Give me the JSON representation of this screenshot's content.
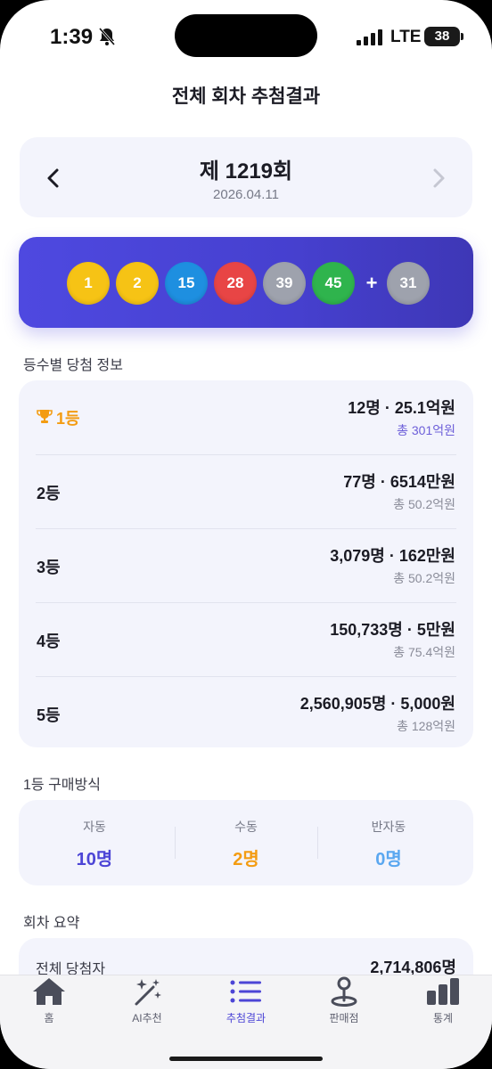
{
  "status": {
    "time": "1:39",
    "network": "LTE",
    "battery": "38"
  },
  "header": {
    "title": "전체 회차 추첨결과"
  },
  "round": {
    "title": "제 1219회",
    "date": "2026.04.11"
  },
  "balls": [
    {
      "number": "1",
      "color": "#f6c315"
    },
    {
      "number": "2",
      "color": "#f6c315"
    },
    {
      "number": "15",
      "color": "#1e8fe0"
    },
    {
      "number": "28",
      "color": "#e84545"
    },
    {
      "number": "39",
      "color": "#9ea2ad"
    },
    {
      "number": "45",
      "color": "#2fb44d"
    }
  ],
  "plus": "+",
  "bonus": {
    "number": "31",
    "color": "#9ea2ad"
  },
  "prize_section": {
    "label": "등수별 당첨 정보"
  },
  "prizes": [
    {
      "rank": "1등",
      "main": "12명 · 25.1억원",
      "total": "총 301억원"
    },
    {
      "rank": "2등",
      "main": "77명 · 6514만원",
      "total": "총 50.2억원"
    },
    {
      "rank": "3등",
      "main": "3,079명 · 162만원",
      "total": "총 50.2억원"
    },
    {
      "rank": "4등",
      "main": "150,733명 · 5만원",
      "total": "총 75.4억원"
    },
    {
      "rank": "5등",
      "main": "2,560,905명 · 5,000원",
      "total": "총 128억원"
    }
  ],
  "method_section": {
    "label": "1등 구매방식"
  },
  "methods": [
    {
      "label": "자동",
      "value": "10명",
      "color": "#4c45d6"
    },
    {
      "label": "수동",
      "value": "2명",
      "color": "#f39c12"
    },
    {
      "label": "반자동",
      "value": "0명",
      "color": "#5aa7f0"
    }
  ],
  "summary_section": {
    "label": "회차 요약"
  },
  "summary": {
    "label": "전체 당첨자",
    "value": "2,714,806명"
  },
  "tabs": [
    {
      "label": "홈",
      "icon": "home-icon"
    },
    {
      "label": "AI추천",
      "icon": "magic-wand-icon"
    },
    {
      "label": "추첨결과",
      "icon": "list-icon",
      "active": true
    },
    {
      "label": "판매점",
      "icon": "map-pin-icon"
    },
    {
      "label": "통계",
      "icon": "bar-chart-icon"
    }
  ]
}
